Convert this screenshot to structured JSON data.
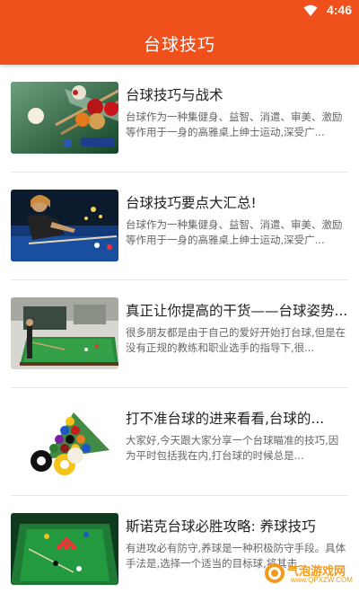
{
  "status": {
    "time": "4:46"
  },
  "appbar": {
    "title": "台球技巧"
  },
  "articles": [
    {
      "title": "台球技巧与战术",
      "desc": "台球作为一种集健身、益智、消遣、审美、激励等作用于一身的高雅桌上绅士运动,深受广..."
    },
    {
      "title": "台球技巧要点大汇总!",
      "desc": "台球作为一种集健身、益智、消遣、审美、激励等作用于一身的高雅桌上绅士运动,深受广..."
    },
    {
      "title": "真正让你提高的干货——台球姿势...",
      "desc": "很多朋友都是由于自己的爱好开始打台球,但是在没有正规的教练和职业选手的指导下,很..."
    },
    {
      "title": "打不准台球的进来看看,台球的...",
      "desc": "大家好,今天跟大家分享一个台球瞄准的技巧,因为平时包括我在内,打台球的时候总是..."
    },
    {
      "title": "斯诺克台球必胜攻略: 养球技巧",
      "desc": "有进攻必有防守,养球是一种积极防守手段。具体手法是,选择一个适当的目标球,将其击..."
    }
  ],
  "watermark": {
    "name": "气泡游戏网",
    "url": "www.QPXZW.COM"
  },
  "colors": {
    "accent": "#f0501c",
    "title_text": "#222222",
    "desc_text": "#666666"
  }
}
